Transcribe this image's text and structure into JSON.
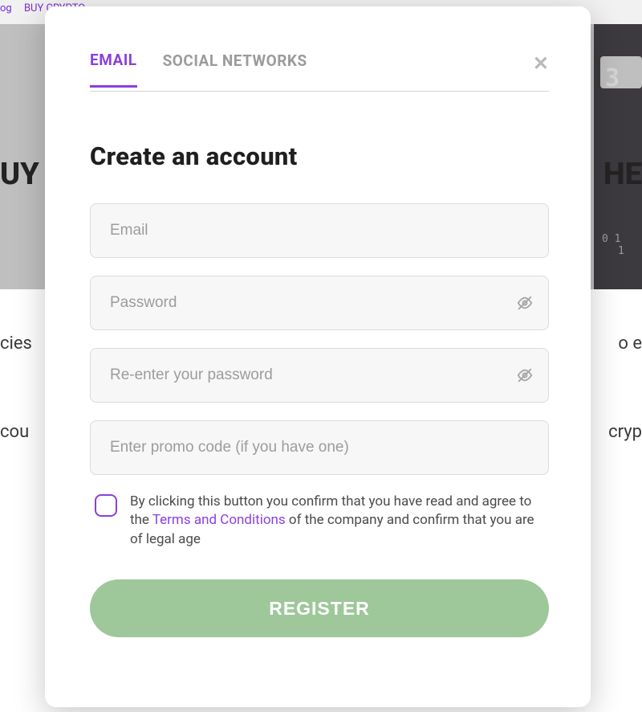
{
  "bg": {
    "nav1": "og",
    "nav2": "BUY CRYPTO",
    "hero_left": "UY",
    "hero_right": "HE",
    "line2_left": "cies",
    "line2_right": "o e",
    "line3_left": "cou",
    "line3_right": "cryp",
    "darkbox_num1": "3",
    "darkbox_num2": "0 1",
    "darkbox_num3": "1"
  },
  "tabs": {
    "email": "EMAIL",
    "social": "SOCIAL NETWORKS"
  },
  "title": "Create an account",
  "fields": {
    "email_placeholder": "Email",
    "password_placeholder": "Password",
    "reenter_placeholder": "Re-enter your password",
    "promo_placeholder": "Enter promo code (if you have one)"
  },
  "terms": {
    "pre": "By clicking this button you confirm that you have read and agree to the ",
    "link": "Terms and Conditions",
    "post": " of the company and confirm that you are of legal age"
  },
  "buttons": {
    "register": "REGISTER"
  },
  "colors": {
    "accent": "#8b3fe0",
    "register_bg": "#9ec79a"
  }
}
